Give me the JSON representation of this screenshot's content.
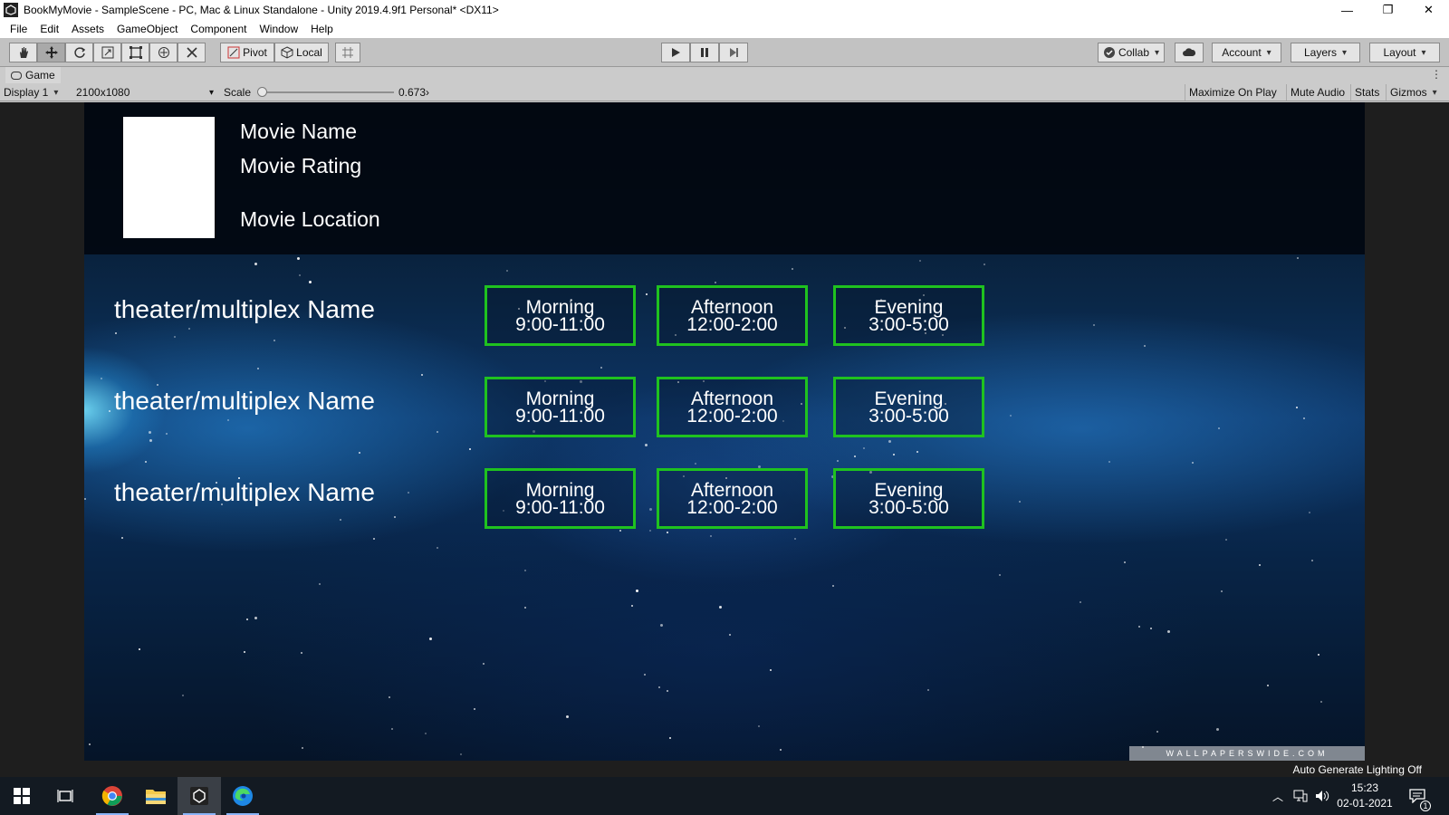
{
  "window": {
    "title": "BookMyMovie - SampleScene - PC, Mac & Linux Standalone - Unity 2019.4.9f1 Personal* <DX11>",
    "minimize": "—",
    "restore": "❐",
    "close": "✕"
  },
  "menu": [
    "File",
    "Edit",
    "Assets",
    "GameObject",
    "Component",
    "Window",
    "Help"
  ],
  "toolbar": {
    "pivot_label": "Pivot",
    "local_label": "Local",
    "collab_label": "Collab",
    "account_label": "Account",
    "layers_label": "Layers",
    "layout_label": "Layout"
  },
  "game_tab": {
    "label": "Game",
    "display": "Display 1",
    "resolution": "2100x1080",
    "scale_label": "Scale",
    "scale_value": "0.673",
    "scale_fraction": 0.0,
    "maximize_on_play": "Maximize On Play",
    "mute_audio": "Mute Audio",
    "stats": "Stats",
    "gizmos": "Gizmos"
  },
  "scene": {
    "movie_name": "Movie Name",
    "movie_rating": "Movie Rating",
    "movie_location": "Movie Location",
    "theaters": [
      {
        "name": "theater/multiplex Name",
        "slots": [
          {
            "period": "Morning",
            "time": "9:00-11:00"
          },
          {
            "period": "Afternoon",
            "time": "12:00-2:00"
          },
          {
            "period": "Evening",
            "time": "3:00-5:00"
          }
        ]
      },
      {
        "name": "theater/multiplex Name",
        "slots": [
          {
            "period": "Morning",
            "time": "9:00-11:00"
          },
          {
            "period": "Afternoon",
            "time": "12:00-2:00"
          },
          {
            "period": "Evening",
            "time": "3:00-5:00"
          }
        ]
      },
      {
        "name": "theater/multiplex Name",
        "slots": [
          {
            "period": "Morning",
            "time": "9:00-11:00"
          },
          {
            "period": "Afternoon",
            "time": "12:00-2:00"
          },
          {
            "period": "Evening",
            "time": "3:00-5:00"
          }
        ]
      }
    ],
    "watermark": "WALLPAPERSWIDE.COM",
    "slot_border_color": "#1fc21f"
  },
  "status": {
    "text": "Auto Generate Lighting Off"
  },
  "taskbar": {
    "apps": [
      "windows-start-icon",
      "task-view-icon",
      "chrome-icon",
      "file-explorer-icon",
      "unity-icon",
      "edge-icon"
    ],
    "time": "15:23",
    "date": "02-01-2021",
    "notification_count": "1"
  }
}
